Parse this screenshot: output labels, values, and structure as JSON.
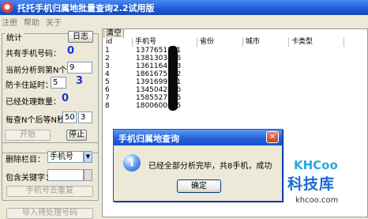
{
  "window": {
    "title": "托托手机归属地批量查询2.2试用版",
    "icon": "app-icon"
  },
  "menu": [
    "注册",
    "帮助",
    "关于"
  ],
  "left": {
    "stats_group": "统计",
    "log_button": "日志",
    "total_phones_label": "共有手机号码：",
    "total_phones_value": "0",
    "current_label": "当前分析到第N个：",
    "current_value": "9",
    "delay_label": "防卡住延时：",
    "delay_value": "5",
    "delay_unit_value": "3",
    "processed_label": "已经处理数量：",
    "processed_value": "0",
    "pause_label": "每查N个后等N秒:",
    "pause_n_value": "50",
    "pause_s_value": "3",
    "start_button": "开始",
    "stop_button": "停止",
    "delete_label": "删除栏目：",
    "delete_select": "手机号",
    "contains_label": "包含关键字：",
    "contains_value": "",
    "dedupe_button": "手机号去重复",
    "import_button": "导入待处理号码"
  },
  "grid": {
    "tab": "清空",
    "columns": [
      "id",
      "手机号",
      "省份",
      "城市",
      "卡类型"
    ],
    "rows": [
      [
        "1",
        "1377651211"
      ],
      [
        "2",
        "1381303486"
      ],
      [
        "3",
        "1361164633"
      ],
      [
        "4",
        "1861675222"
      ],
      [
        "5",
        "1391699721"
      ],
      [
        "6",
        "1345042896"
      ],
      [
        "7",
        "1585527255"
      ],
      [
        "8",
        "1800600675"
      ]
    ]
  },
  "dialog": {
    "title": "手机归属地查询",
    "message": "已经全部分析完毕，共8手机，成功",
    "ok_button": "确定",
    "icon": "info-icon"
  },
  "watermark": {
    "logo": "KHCoo",
    "name": "科技库",
    "url": "khcoo.com"
  }
}
